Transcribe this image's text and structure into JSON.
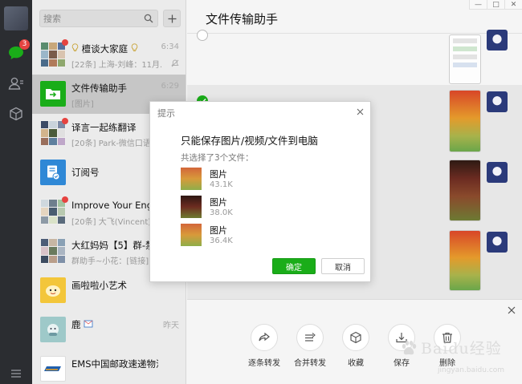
{
  "search": {
    "placeholder": "搜索"
  },
  "nav": {
    "chat_badge": "3"
  },
  "chats": [
    {
      "name": "檀谈大家庭",
      "preview": "[22条] 上海-刘峰：11月...",
      "time": "6:34"
    },
    {
      "name": "文件传输助手",
      "preview": "[图片]",
      "time": "6:29"
    },
    {
      "name": "译言一起练翻译",
      "preview": "[20条] Park-微信口语培...",
      "time": ""
    },
    {
      "name": "订阅号",
      "preview": "",
      "time": ""
    },
    {
      "name": "Improve Your English",
      "preview": "[20条] 大飞(Vincent)：",
      "time": ""
    },
    {
      "name": "大红妈妈【5】群-禁...",
      "preview": "群助手~小花：[链接]",
      "time": ""
    },
    {
      "name": "画啦啦小艺术",
      "preview": "",
      "time": ""
    },
    {
      "name": "鹿",
      "preview": "",
      "time": "昨天"
    },
    {
      "name": "EMS中国邮政速递物流",
      "preview": "",
      "time": ""
    }
  ],
  "conversation": {
    "title": "文件传输助手"
  },
  "window_buttons": [
    "—",
    "□",
    "✕"
  ],
  "dialog": {
    "title": "提示",
    "message": "只能保存图片/视频/文件到电脑",
    "selection_count": "共选择了3个文件：",
    "files": [
      {
        "name": "图片",
        "size": "43.1K"
      },
      {
        "name": "图片",
        "size": "38.0K"
      },
      {
        "name": "图片",
        "size": "36.4K"
      }
    ],
    "confirm": "确定",
    "cancel": "取消"
  },
  "multiselect": {
    "actions": [
      {
        "label": "逐条转发",
        "icon": "share-icon"
      },
      {
        "label": "合并转发",
        "icon": "merge-forward-icon"
      },
      {
        "label": "收藏",
        "icon": "favorite-cube-icon"
      },
      {
        "label": "保存",
        "icon": "save-download-icon"
      },
      {
        "label": "删除",
        "icon": "trash-icon"
      }
    ]
  },
  "watermark": {
    "text": "Baidu经验",
    "url": "jingyan.baidu.com"
  }
}
